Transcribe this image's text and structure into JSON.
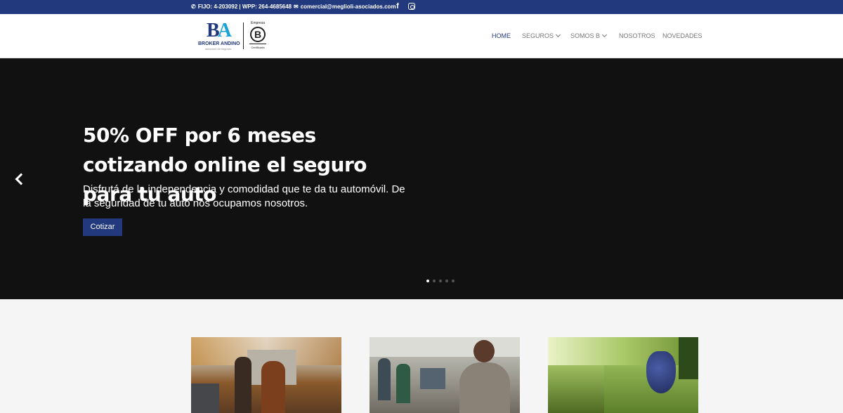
{
  "topbar": {
    "phone": "FIJO: 4-203092 | WPP: 264-4685648",
    "email": "comercial@meglioli-asociados.com",
    "social": [
      "facebook-icon",
      "instagram-icon"
    ]
  },
  "logo": {
    "mark_b": "B",
    "mark_a": "A",
    "name": "BROKER ANDINO",
    "sub": "asesores de seguros",
    "bcorp_top": "Empresa",
    "bcorp_letter": "B",
    "bcorp_bottom": "Certificada"
  },
  "nav": {
    "items": [
      {
        "label": "HOME",
        "dropdown": false,
        "active": true
      },
      {
        "label": "SEGUROS",
        "dropdown": true,
        "active": false
      },
      {
        "label": "SOMOS B",
        "dropdown": true,
        "active": false
      },
      {
        "label": "NOSOTROS",
        "dropdown": false,
        "active": false
      },
      {
        "label": "NOVEDADES",
        "dropdown": false,
        "active": false
      }
    ]
  },
  "hero": {
    "title": "50% OFF por 6 meses cotizando online el seguro para tu auto",
    "description": "Disfrutá de la independencia y comodidad que te da tu automóvil. De la seguridad de tu auto nos ocupamos nosotros.",
    "cta_label": "Cotizar",
    "slides_total": 5,
    "active_slide": 1
  },
  "colors": {
    "brand": "#223a7d",
    "accent": "#1aa3d8",
    "hero_bg": "#111111"
  }
}
